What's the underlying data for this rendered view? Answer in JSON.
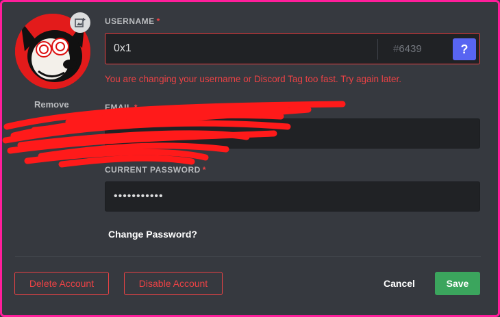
{
  "avatar": {
    "remove_label": "Remove",
    "upload_icon": "image-plus-icon"
  },
  "username": {
    "label": "USERNAME",
    "required_mark": "*",
    "value": "0x1",
    "tag_hash": "#",
    "tag_number": "6439",
    "help_label": "?",
    "error": "You are changing your username or Discord Tag too fast. Try again later."
  },
  "email": {
    "label": "EMAIL",
    "required_mark": "*"
  },
  "password": {
    "label": "CURRENT PASSWORD",
    "required_mark": "*",
    "value": "•••••••••••"
  },
  "change_password_label": "Change Password?",
  "actions": {
    "delete_label": "Delete Account",
    "disable_label": "Disable Account",
    "cancel_label": "Cancel",
    "save_label": "Save"
  },
  "colors": {
    "background": "#36393f",
    "input_bg": "#202225",
    "danger": "#ed4245",
    "blurple": "#5865f2",
    "success": "#3ba55d",
    "frame": "#ff1e9a"
  }
}
